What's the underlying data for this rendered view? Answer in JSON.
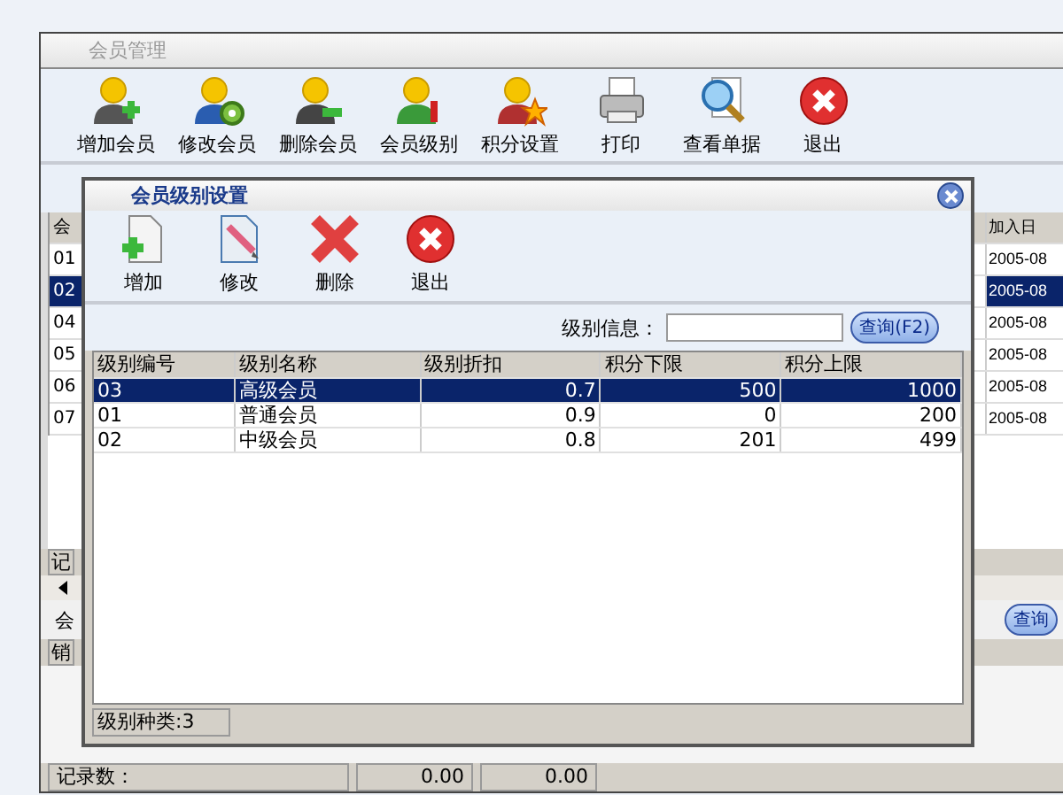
{
  "main_window": {
    "title": "会员管理",
    "toolbar": [
      {
        "kind": "add",
        "label": "增加会员"
      },
      {
        "kind": "edit",
        "label": "修改会员"
      },
      {
        "kind": "remove",
        "label": "删除会员"
      },
      {
        "kind": "level",
        "label": "会员级别"
      },
      {
        "kind": "points",
        "label": "积分设置"
      },
      {
        "kind": "print",
        "label": "打印"
      },
      {
        "kind": "view",
        "label": "查看单据"
      },
      {
        "kind": "exit",
        "label": "退出"
      }
    ],
    "table": {
      "columns": [
        "会",
        "加入日"
      ],
      "rows": [
        {
          "code": "01",
          "date": "2005-08",
          "selected": false
        },
        {
          "code": "02",
          "date": "2005-08",
          "selected": true
        },
        {
          "code": "04",
          "date": "2005-08",
          "selected": false
        },
        {
          "code": "05",
          "date": "2005-08",
          "selected": false
        },
        {
          "code": "06",
          "date": "2005-08",
          "selected": false
        },
        {
          "code": "07",
          "date": "2005-08",
          "selected": false
        }
      ]
    },
    "lower_tab": "记",
    "section_label": "会",
    "query_button": "查询",
    "sub_header": "销",
    "status_bar": {
      "record_count_label": "记录数：",
      "totals": [
        "0.00",
        "0.00"
      ]
    }
  },
  "dialog": {
    "title": "会员级别设置",
    "toolbar": [
      {
        "kind": "add",
        "label": "增加"
      },
      {
        "kind": "edit",
        "label": "修改"
      },
      {
        "kind": "delete",
        "label": "删除"
      },
      {
        "kind": "exit",
        "label": "退出"
      }
    ],
    "search": {
      "label": "级别信息：",
      "button": "查询(F2)"
    },
    "table": {
      "columns": [
        "级别编号",
        "级别名称",
        "级别折扣",
        "积分下限",
        "积分上限"
      ],
      "rows": [
        {
          "cells": [
            "03",
            "高级会员",
            "0.7",
            "500",
            "1000"
          ],
          "selected": true
        },
        {
          "cells": [
            "01",
            "普通会员",
            "0.9",
            "0",
            "200"
          ],
          "selected": false
        },
        {
          "cells": [
            "02",
            "中级会员",
            "0.8",
            "201",
            "499"
          ],
          "selected": false
        }
      ]
    },
    "status": "级别种类:3"
  }
}
